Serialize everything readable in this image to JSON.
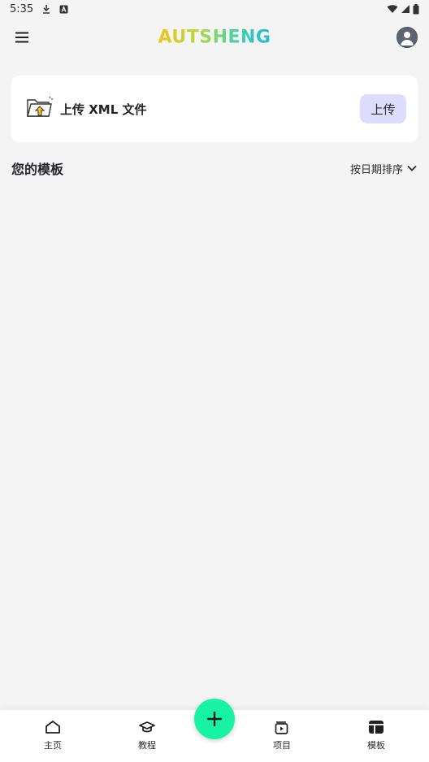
{
  "status_bar": {
    "time": "5:35",
    "icons": [
      "download-icon",
      "a-badge-icon",
      "wifi-icon",
      "signal-icon",
      "battery-icon"
    ]
  },
  "header": {
    "logo_text": "AUTSHENG",
    "menu_icon": "menu-icon",
    "profile_icon": "account-icon"
  },
  "upload_card": {
    "icon": "folder-upload-icon",
    "label": "上传 XML 文件",
    "button_label": "上传"
  },
  "templates_section": {
    "title": "您的模板",
    "sort_label": "按日期排序",
    "items": []
  },
  "bottom_nav": {
    "items": [
      {
        "label": "主页",
        "icon": "home-icon",
        "active": false
      },
      {
        "label": "教程",
        "icon": "graduation-cap-icon",
        "active": false
      },
      {
        "label": "项目",
        "icon": "video-library-icon",
        "active": false
      },
      {
        "label": "模板",
        "icon": "template-icon",
        "active": true
      }
    ],
    "fab_icon": "plus-icon"
  },
  "colors": {
    "background": "#f4f4f5",
    "fab": "#17f2a4",
    "upload_button_bg": "#dcdcfb",
    "logo_gradient": [
      "#f3c21a",
      "#3fd2a6",
      "#27b7d6"
    ]
  }
}
